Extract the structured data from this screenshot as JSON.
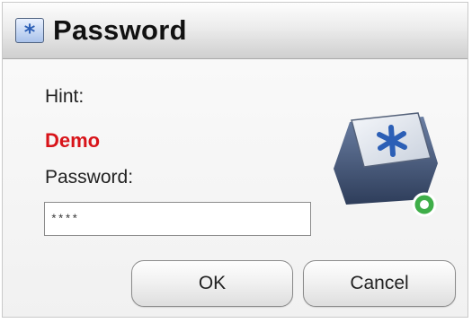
{
  "window": {
    "title": "Password",
    "title_icon": "asterisk-window-icon"
  },
  "form": {
    "hint_label": "Hint:",
    "hint_value": "Demo",
    "password_label": "Password:",
    "password_value": "****"
  },
  "buttons": {
    "ok_label": "OK",
    "cancel_label": "Cancel"
  },
  "icons": {
    "key": "asterisk-key-icon",
    "status": "green-ring-icon"
  },
  "colors": {
    "hint_value": "#d8141a",
    "key_accent": "#2c5fb6",
    "status_ring": "#3fae49"
  }
}
